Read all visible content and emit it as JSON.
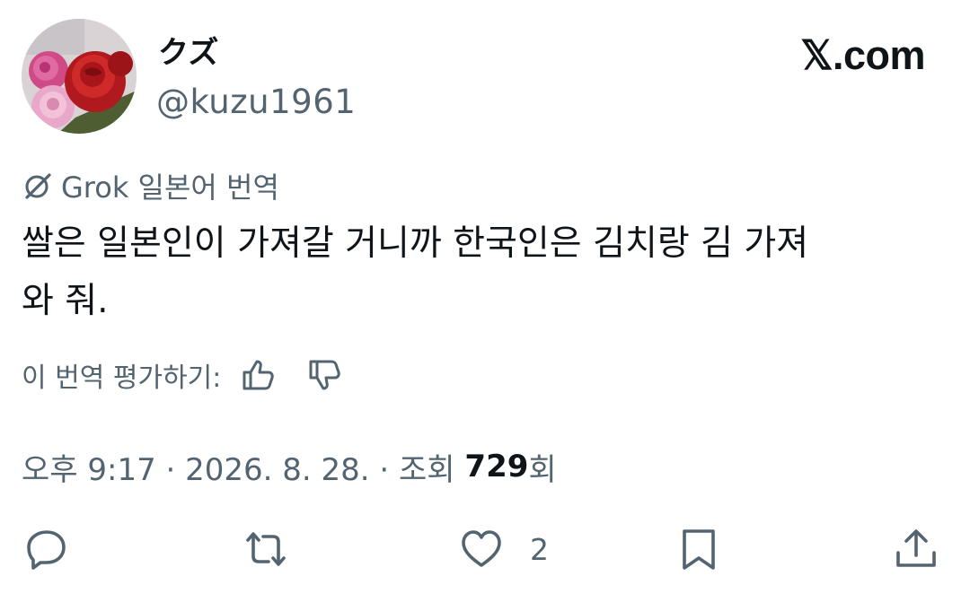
{
  "user": {
    "display_name": "クズ",
    "handle": "@kuzu1961",
    "avatar_icon": "rose-avatar"
  },
  "brand": {
    "label": "𝕏.com"
  },
  "translation": {
    "icon": "grok-icon",
    "label": "Grok 일본어 번역"
  },
  "tweet": {
    "text": "쌀은 일본인이 가져갈 거니까 한국인은 김치랑 김 가져\n와 줘."
  },
  "rating": {
    "label": "이 번역 평가하기:",
    "thumbs_up_icon": "thumbs-up-icon",
    "thumbs_down_icon": "thumbs-down-icon"
  },
  "meta": {
    "time_date": "오후 9:17 · 2026. 8. 28. · 조회 ",
    "views_count": "729",
    "views_suffix": "회"
  },
  "actions": {
    "reply_icon": "reply-icon",
    "retweet_icon": "retweet-icon",
    "like_icon": "heart-icon",
    "like_count": "2",
    "bookmark_icon": "bookmark-icon",
    "share_icon": "share-icon"
  },
  "colors": {
    "text_primary": "#0f1419",
    "text_secondary": "#536471",
    "background": "#ffffff"
  }
}
